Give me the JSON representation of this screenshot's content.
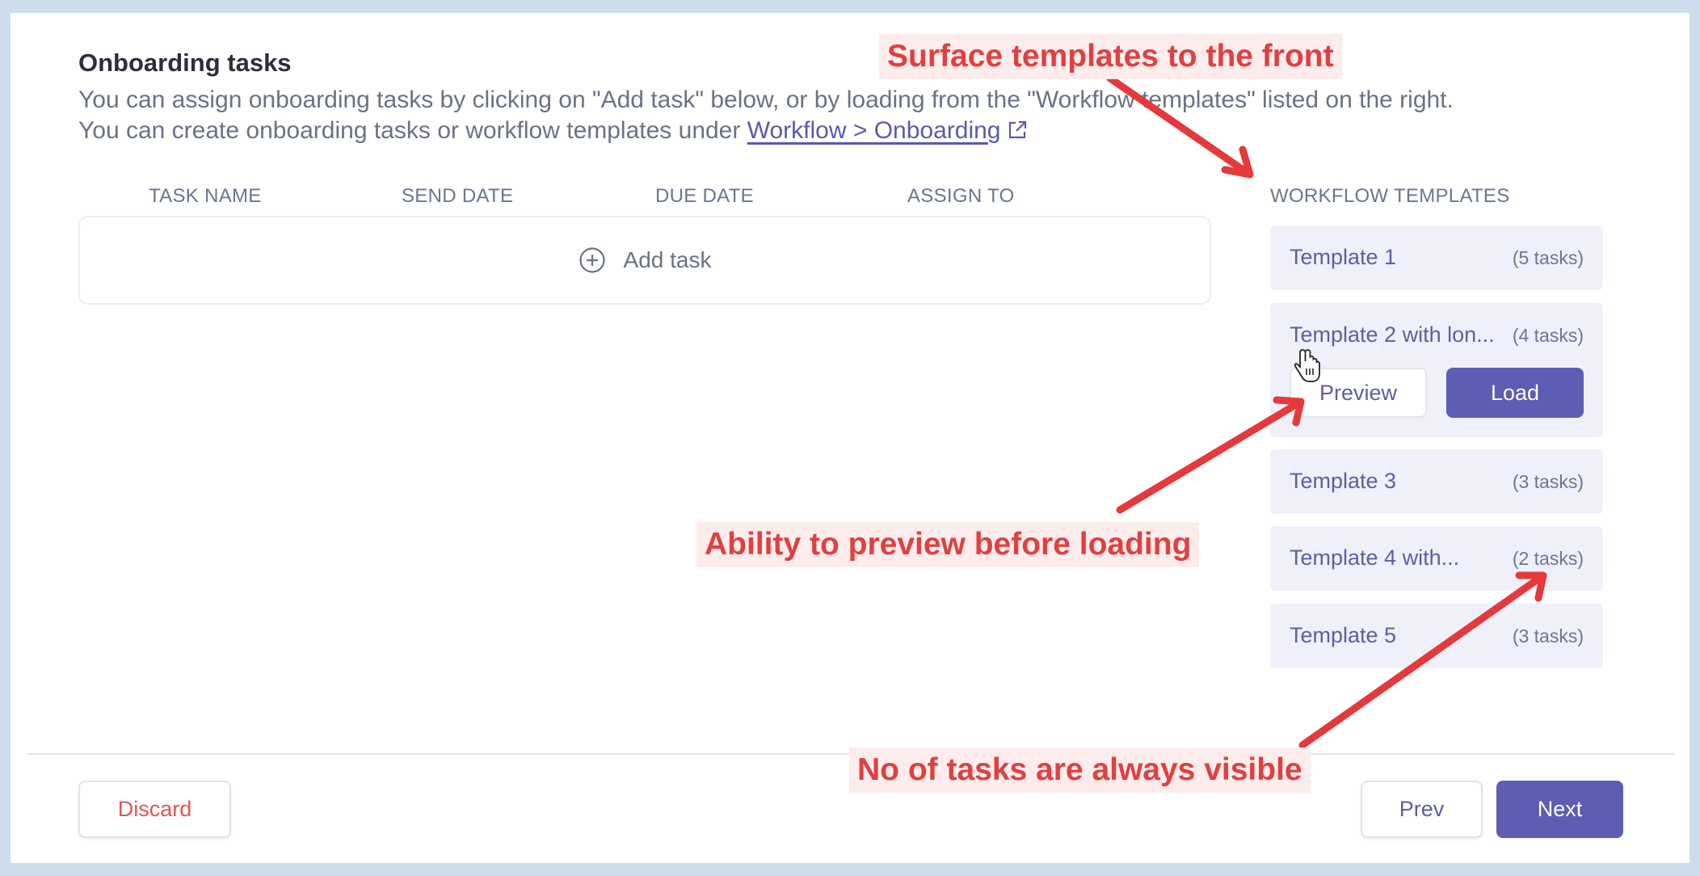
{
  "section": {
    "title": "Onboarding tasks",
    "description_line1": "You can assign onboarding tasks by clicking on \"Add task\" below, or by loading from the \"Workflow templates\" listed on the right.",
    "description_line2_prefix": "You can create onboarding tasks or workflow templates under ",
    "description_link": "Workflow > Onboarding",
    "external_icon": "external-link-icon"
  },
  "table": {
    "columns": [
      "TASK NAME",
      "SEND DATE",
      "DUE DATE",
      "ASSIGN TO"
    ],
    "add_task_label": "Add task",
    "add_icon": "plus-circle-icon"
  },
  "workflow_templates": {
    "heading": "WORKFLOW TEMPLATES",
    "items": [
      {
        "name": "Template 1",
        "count": "(5 tasks)"
      },
      {
        "name": "Template 2 with lon...",
        "count": "(4 tasks)",
        "expanded": true,
        "preview_label": "Preview",
        "load_label": "Load"
      },
      {
        "name": "Template 3",
        "count": "(3 tasks)"
      },
      {
        "name": "Template 4 with...",
        "count": "(2 tasks)"
      },
      {
        "name": "Template 5",
        "count": "(3 tasks)"
      }
    ]
  },
  "footer": {
    "discard_label": "Discard",
    "prev_label": "Prev",
    "next_label": "Next"
  },
  "annotations": {
    "top": "Surface templates to the front",
    "middle": "Ability to preview before loading",
    "bottom": "No of tasks are always visible"
  },
  "colors": {
    "accent": "#5d5db3",
    "annotation": "#e04040",
    "background": "#cdddee"
  }
}
